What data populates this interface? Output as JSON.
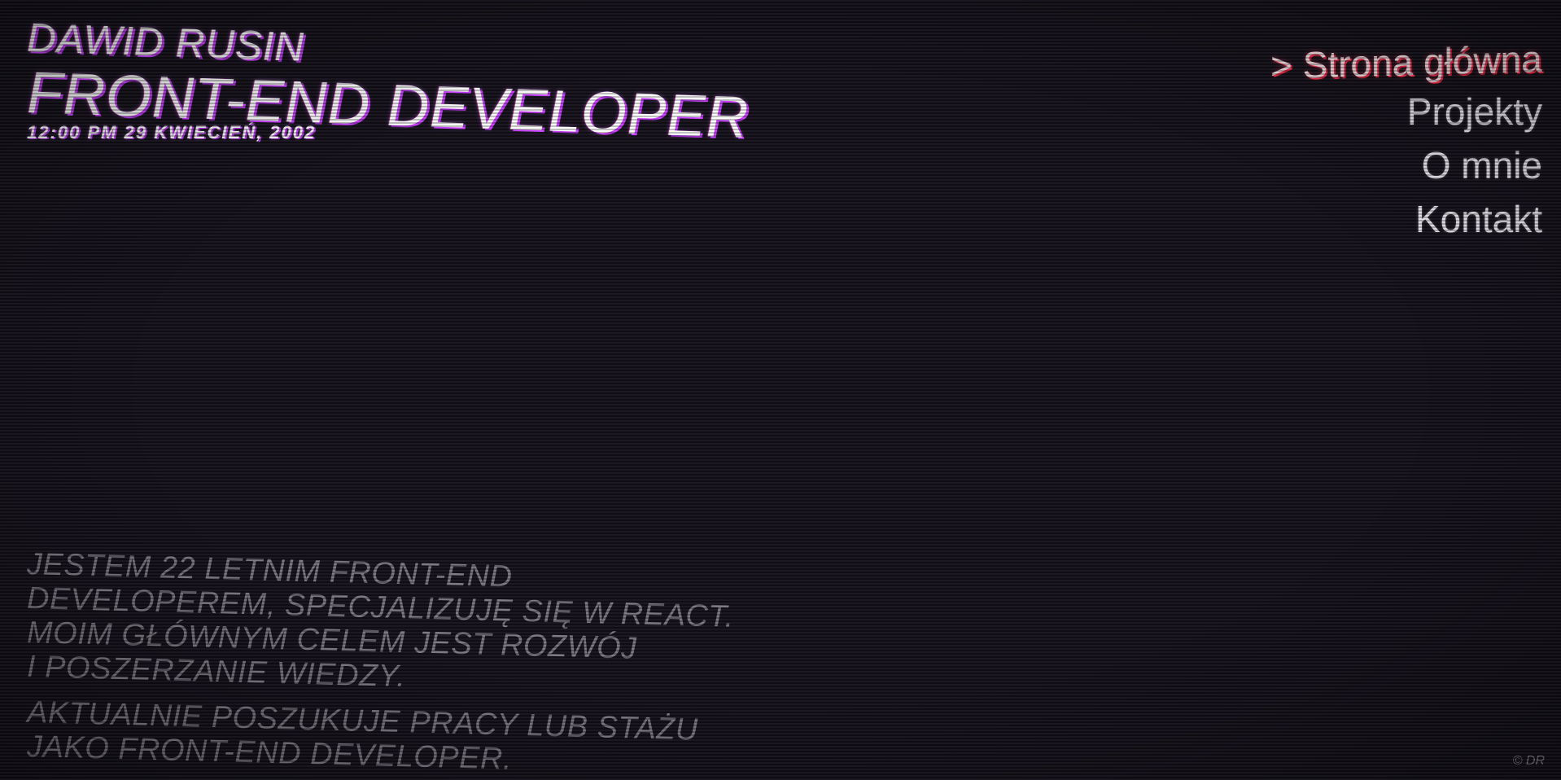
{
  "header": {
    "name": "DAWID RUSIN",
    "role": "FRONT-END DEVELOPER",
    "datetime": "12:00 PM 29 KWIECIEŃ, 2002"
  },
  "nav": {
    "items": [
      {
        "label": "> Strona główna",
        "active": true
      },
      {
        "label": "Projekty",
        "active": false
      },
      {
        "label": "O mnie",
        "active": false
      },
      {
        "label": "Kontakt",
        "active": false
      }
    ]
  },
  "bio": {
    "paragraph1": [
      "JESTEM 22 LETNIM FRONT-END",
      "DEVELOPEREM, SPECJALIZUJĘ SIĘ W REACT.",
      "MOIM GŁÓWNYM CELEM JEST ROZWÓJ",
      "I POSZERZANIE WIEDZY."
    ],
    "paragraph2": [
      "AKTUALNIE POSZUKUJE PRACY LUB STAŻU",
      "JAKO FRONT-END DEVELOPER."
    ]
  },
  "footer": {
    "copyright": "© DR"
  },
  "colors": {
    "background": "#15111b",
    "glitch_accent": "#c83cff",
    "active_nav_accent": "#ff2a4a",
    "bio_text": "#7a7680"
  }
}
